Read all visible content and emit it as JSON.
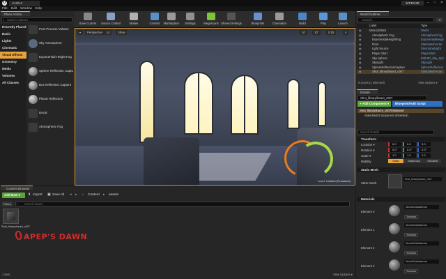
{
  "titlebar": {
    "tab": "Untitled",
    "project": "MT40130",
    "min": "–",
    "max": "□",
    "close": "✕"
  },
  "menu": [
    "File",
    "Edit",
    "Window",
    "Help"
  ],
  "place_actors": {
    "tab": "Place Actors",
    "search_placeholder": "Search Classes",
    "categories": [
      "Recently Placed",
      "Basic",
      "Lights",
      "Cinematic",
      "Visual Effects",
      "Geometry",
      "Media",
      "Volumes",
      "All Classes"
    ],
    "selected_category": "Visual Effects",
    "items": [
      "Post Process Volume",
      "Sky Atmosphere",
      "Exponential Height Fog",
      "Sphere Reflection Captu",
      "Box Reflection Capture",
      "Planar Reflection",
      "Decal",
      "Atmospheric Fog"
    ]
  },
  "toolbar": {
    "items": [
      {
        "label": "Save Current",
        "color": "#888888"
      },
      {
        "label": "Source Control",
        "color": "#8aa0c8"
      },
      {
        "label": "Modes",
        "color": "#b0b0b0"
      },
      {
        "label": "Content",
        "color": "#5a90c8"
      },
      {
        "label": "Marketplace",
        "color": "#9a9a9a"
      },
      {
        "label": "Settings",
        "color": "#909090"
      },
      {
        "label": "Megascans",
        "color": "#7dc43a"
      },
      {
        "label": "Shared Settings",
        "color": "#555555"
      },
      {
        "label": "Blueprints",
        "color": "#6a8fd0"
      },
      {
        "label": "Cinematics",
        "color": "#999999"
      },
      {
        "label": "Build",
        "color": "#4a86c8"
      },
      {
        "label": "Play",
        "color": "#5a96d8"
      },
      {
        "label": "Launch",
        "color": "#5a90c8"
      }
    ]
  },
  "viewport": {
    "perspective_label": "Perspective",
    "lit_label": "Lit",
    "show_label": "Show",
    "grid_value": "10",
    "angle_value": "10°",
    "scale_value": "0.25",
    "cam_speed": "4",
    "watermark": "Level: Untitled (Persistent)"
  },
  "outliner": {
    "tab": "World Outliner",
    "search_placeholder": "Search...",
    "col_label": "Label",
    "col_type": "Type",
    "rows": [
      {
        "label": "Main (Editor)",
        "type": "World"
      },
      {
        "label": "Atmospheric Fog",
        "type": "AtmosphericFog"
      },
      {
        "label": "ExponentialHeightFog",
        "type": "ExponentialHeigh"
      },
      {
        "label": "Floor",
        "type": "StaticMeshActor"
      },
      {
        "label": "Light Source",
        "type": "DirectionalLight"
      },
      {
        "label": "Player Start",
        "type": "PlayerStart"
      },
      {
        "label": "Sky Sphere",
        "type": "Edit BP_Sky_Sph"
      },
      {
        "label": "SkyLight",
        "type": "SkyLight"
      },
      {
        "label": "SphereReflectionCapture",
        "type": "SphereReflection"
      },
      {
        "label": "Shot_library/kaunt_c007",
        "type": "StaticMeshActor"
      }
    ],
    "selected_row": 9,
    "status": "9 actors (1 selected)",
    "view_options": "View Options ▾"
  },
  "details": {
    "tab": "Details",
    "name_value": "Shot_library/kaunt_c007",
    "add_component": "+ Add Component ▾",
    "blueprint_button": "Blueprint/Add Script",
    "components": [
      "Shot_library/kaunt_c007(Instance)",
      "StaticMeshComponent (Inherited)"
    ],
    "search_placeholder": "Search Details",
    "transform_header": "Transform",
    "location_label": "Location ▾",
    "rotation_label": "Rotation ▾",
    "scale_label": "Scale ▾",
    "mobility_label": "Mobility",
    "location": [
      "0.0",
      "0.0",
      "0.0"
    ],
    "rotation": [
      "0.0°",
      "0.0°",
      "0.0°"
    ],
    "scale": [
      "1.0",
      "1.0",
      "1.0"
    ],
    "mobility": [
      "Static",
      "Stationary",
      "Movable"
    ],
    "static_mesh_header": "Static Mesh",
    "static_mesh_label": "Static Mesh",
    "static_mesh_value": "Shot_library/kaunt_c007",
    "materials_header": "Materials",
    "elements": [
      "Element 0",
      "Element 1",
      "Element 2",
      "Element 3"
    ],
    "material_name": "WorldGridMaterial",
    "textures_label": "Textures"
  },
  "content_browser": {
    "tab": "Content Browser",
    "add_new": "Add New ▾",
    "import": "Import",
    "save_all": "Save All",
    "path": [
      "Content",
      "assets"
    ],
    "filters": "Filters ▾",
    "search_placeholder": "Search assets",
    "asset_label": "Shot_library/kaunt_c007",
    "items_count": "1 item",
    "view_options": "View Options ▾"
  },
  "logo": {
    "text": "APEP'S DAWN",
    "color": "#d62b2b"
  }
}
